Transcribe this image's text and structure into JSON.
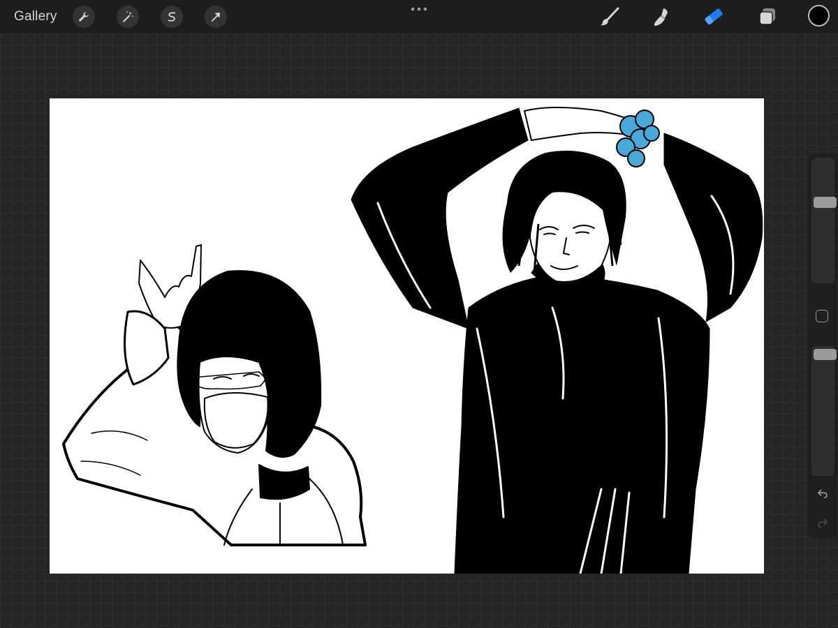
{
  "toolbar": {
    "gallery_label": "Gallery",
    "left_icons": [
      "wrench-icon",
      "magic-wand-icon",
      "selection-s-icon",
      "transform-arrow-icon"
    ],
    "right_tools": [
      "brush-icon",
      "smudge-icon",
      "eraser-icon",
      "layers-icon"
    ],
    "active_tool": "eraser-icon",
    "active_color": "#1f7bf2",
    "current_color": "#000000"
  },
  "sidebar": {
    "brush_size_level": 0.17,
    "opacity_level": 0.06,
    "undo_icon": "undo-icon",
    "redo_icon": "redo-icon"
  },
  "canvas": {
    "background": "#ffffff",
    "accent_scrunchie_color": "#4aa8d8"
  }
}
